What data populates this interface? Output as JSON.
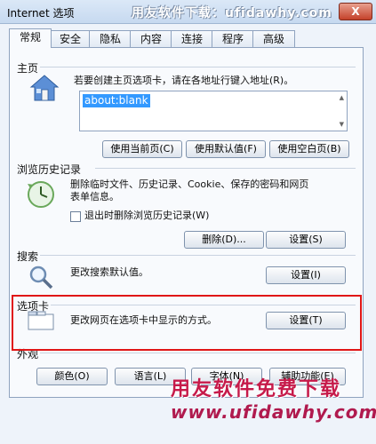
{
  "window": {
    "title": "Internet 选项",
    "close_label": "X"
  },
  "watermark": {
    "top": "用友软件下载：ufidawhy.com",
    "bottom_line1": "用友软件免费下载",
    "bottom_line2": "www.ufidawhy.com"
  },
  "tabs": [
    "常规",
    "安全",
    "隐私",
    "内容",
    "连接",
    "程序",
    "高级"
  ],
  "home": {
    "title": "主页",
    "desc": "若要创建主页选项卡，请在各地址行键入地址(R)。",
    "address": "about:blank",
    "buttons": [
      "使用当前页(C)",
      "使用默认值(F)",
      "使用空白页(B)"
    ]
  },
  "history": {
    "title": "浏览历史记录",
    "desc": "删除临时文件、历史记录、Cookie、保存的密码和网页表单信息。",
    "checkbox_label": "退出时删除浏览历史记录(W)",
    "buttons": [
      "删除(D)...",
      "设置(S)"
    ]
  },
  "search": {
    "title": "搜索",
    "desc": "更改搜索默认值。",
    "button": "设置(I)"
  },
  "tabs_section": {
    "title": "选项卡",
    "desc": "更改网页在选项卡中显示的方式。",
    "button": "设置(T)"
  },
  "appearance": {
    "title": "外观",
    "buttons": [
      "颜色(O)",
      "语言(L)",
      "字体(N)",
      "辅助功能(E)"
    ]
  }
}
